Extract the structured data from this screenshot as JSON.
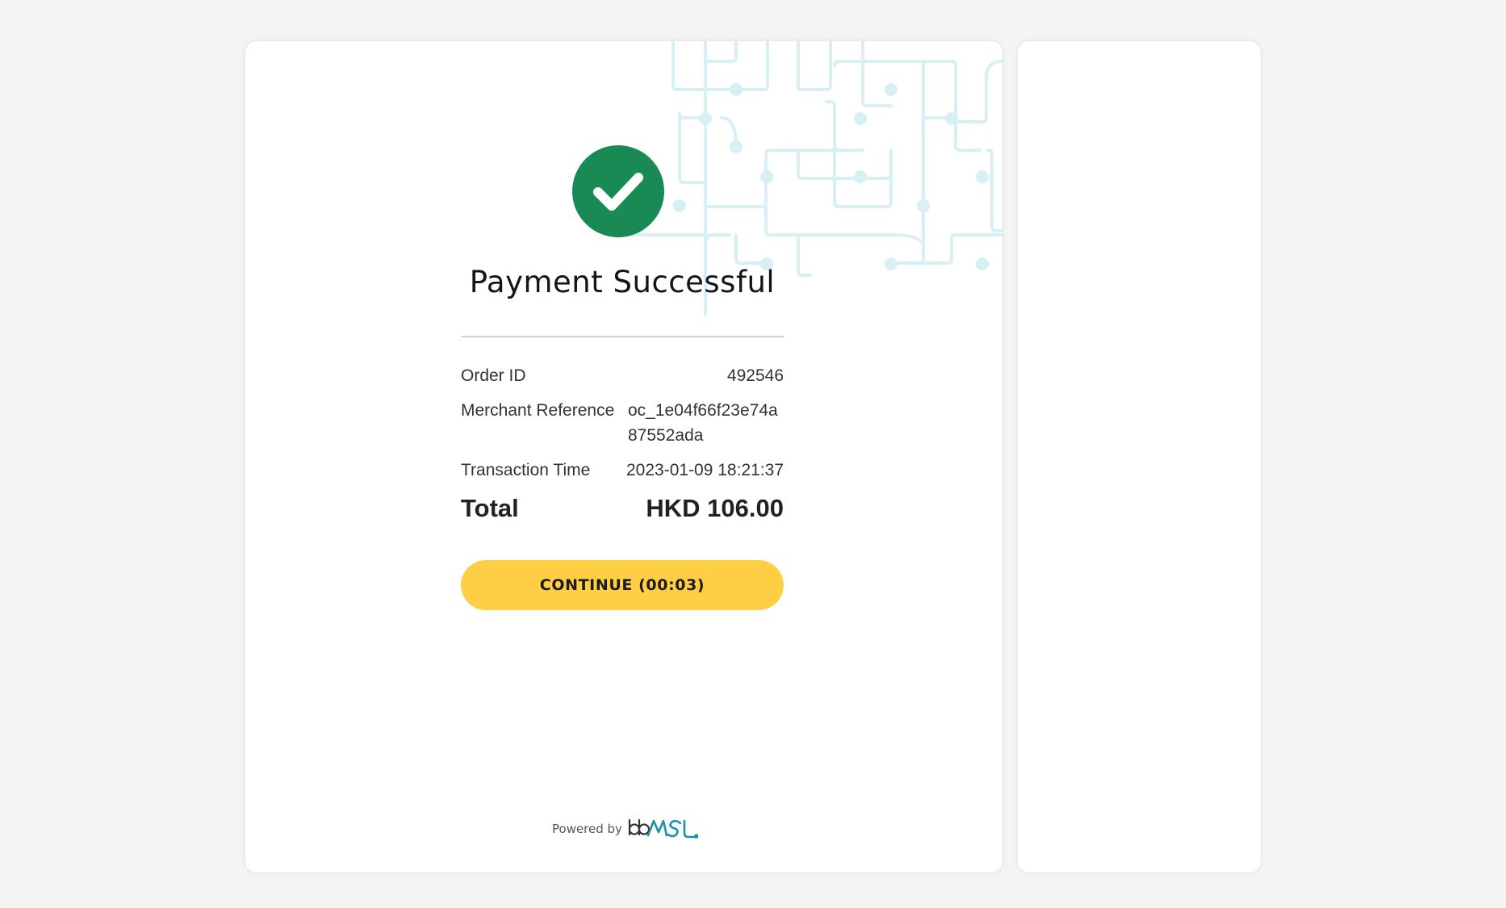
{
  "status": {
    "icon": "check-circle-icon",
    "title": "Payment Successful",
    "color": "#1a8a55"
  },
  "details": {
    "order_id_label": "Order ID",
    "order_id_value": "492546",
    "merchant_ref_label": "Merchant Reference",
    "merchant_ref_value": "oc_1e04f66f23e74a87552ada",
    "transaction_time_label": "Transaction Time",
    "transaction_time_value": "2023-01-09 18:21:37",
    "total_label": "Total",
    "total_value": "HKD 106.00"
  },
  "actions": {
    "continue_label": "CONTINUE (00:03)",
    "continue_color": "#fecf45"
  },
  "footer": {
    "powered_by": "Powered by",
    "logo_text": "bbMSL",
    "logo_color": "#1e8fa8"
  },
  "theme": {
    "background": "#f4f4f4",
    "card": "#ffffff",
    "circuit": "#d6f0f4"
  }
}
